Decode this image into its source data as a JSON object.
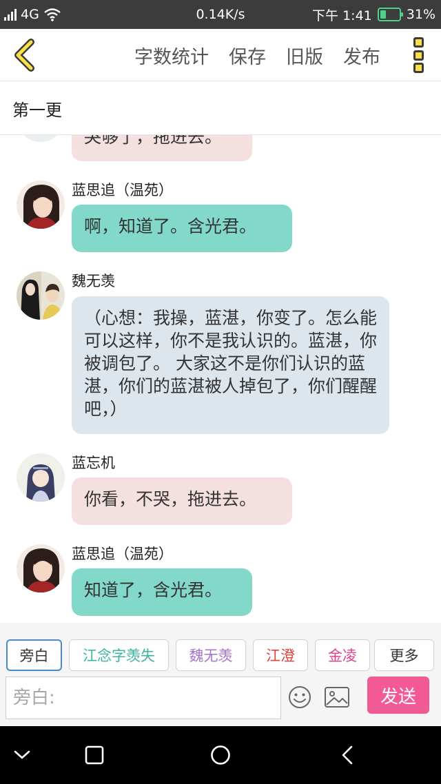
{
  "status_bar": {
    "sim": "2",
    "network": "4G",
    "speed": "0.14K/s",
    "time": "下午 1:41",
    "battery": "31%",
    "battery_level": 0.31
  },
  "header": {
    "actions": [
      "字数统计",
      "保存",
      "旧版",
      "发布"
    ]
  },
  "chapter": {
    "title": "第一更"
  },
  "messages": [
    {
      "name": "",
      "text": "哭够了，拖进去。",
      "style": "pink"
    },
    {
      "name": "蓝思追（温苑）",
      "text": "啊，知道了。含光君。",
      "style": "green"
    },
    {
      "name": "魏无羡",
      "text": "（心想：我操，蓝湛，你变了。怎么能可以这样，你不是我认识的。蓝湛，你被调包了。 大家这不是你们认识的蓝湛，你们的蓝湛被人掉包了，你们醒醒吧，）",
      "style": "blue"
    },
    {
      "name": "蓝忘机",
      "text": "你看，不哭，拖进去。",
      "style": "pink"
    },
    {
      "name": "蓝思追（温苑）",
      "text": "知道了，含光君。",
      "style": "green"
    }
  ],
  "roles": {
    "chips": [
      {
        "label": "旁白",
        "color": "#333333"
      },
      {
        "label": "江念字羡失",
        "color": "#3bb3a0"
      },
      {
        "label": "魏无羡",
        "color": "#a474c8"
      },
      {
        "label": "江澄",
        "color": "#e0413e"
      },
      {
        "label": "金凌",
        "color": "#e0448a"
      },
      {
        "label": "更多",
        "color": "#333333"
      }
    ],
    "input_placeholder": "旁白:",
    "send_label": "发送"
  },
  "icons": {
    "back": "chevron-left-icon",
    "more": "more-icon",
    "emoji": "emoji-icon",
    "image": "image-icon",
    "nav": [
      "chevron-down-icon",
      "square-icon",
      "circle-icon",
      "back-triangle-icon"
    ]
  },
  "colors": {
    "accent_yellow": "#f7e04a",
    "bubble_green": "#82d8c9",
    "bubble_pink": "#f3e0df",
    "bubble_blue": "#dde6ec",
    "send_pink": "#f25a96"
  }
}
